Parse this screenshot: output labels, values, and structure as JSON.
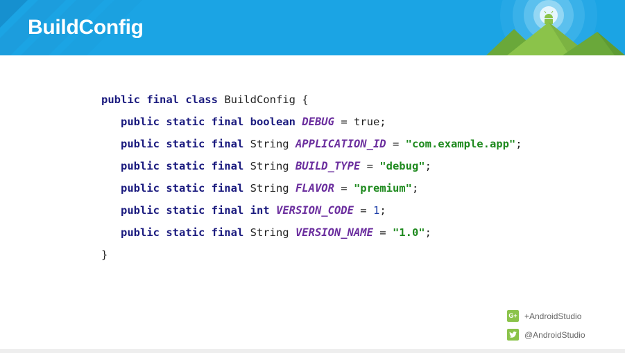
{
  "header": {
    "title": "BuildConfig",
    "colors": {
      "background": "#1ba4e4",
      "mountain": "#8bc34a",
      "android": "#8bc34a"
    }
  },
  "code": {
    "line0": {
      "kw": "public final class",
      "name": " BuildConfig {"
    },
    "line1": {
      "kw": "public static final boolean",
      "field": "DEBUG",
      "op": " = true;"
    },
    "line2": {
      "kw": "public static final",
      "type": " String ",
      "field": "APPLICATION_ID",
      "op": " = ",
      "str": "\"com.example.app\"",
      "end": ";"
    },
    "line3": {
      "kw": "public static final",
      "type": " String ",
      "field": "BUILD_TYPE",
      "op": " = ",
      "str": "\"debug\"",
      "end": ";"
    },
    "line4": {
      "kw": "public static final",
      "type": " String ",
      "field": "FLAVOR",
      "op": " = ",
      "str": "\"premium\"",
      "end": ";"
    },
    "line5": {
      "kw": "public static final int",
      "field": "VERSION_CODE",
      "op": " = ",
      "num": "1",
      "end": ";"
    },
    "line6": {
      "kw": "public static final",
      "type": " String ",
      "field": "VERSION_NAME",
      "op": " = ",
      "str": "\"1.0\"",
      "end": ";"
    },
    "line7": {
      "close": "}"
    },
    "colors": {
      "keyword": "#1a1a7e",
      "field": "#6b2e9e",
      "string": "#1f8a1f",
      "number": "#1c3ea8"
    }
  },
  "social": {
    "gplus_badge": "G+",
    "gplus_icon": "google-plus-icon",
    "gplus": "+AndroidStudio",
    "twitter_icon": "twitter-icon",
    "twitter": "@AndroidStudio",
    "badge_color": "#8bc34a"
  }
}
